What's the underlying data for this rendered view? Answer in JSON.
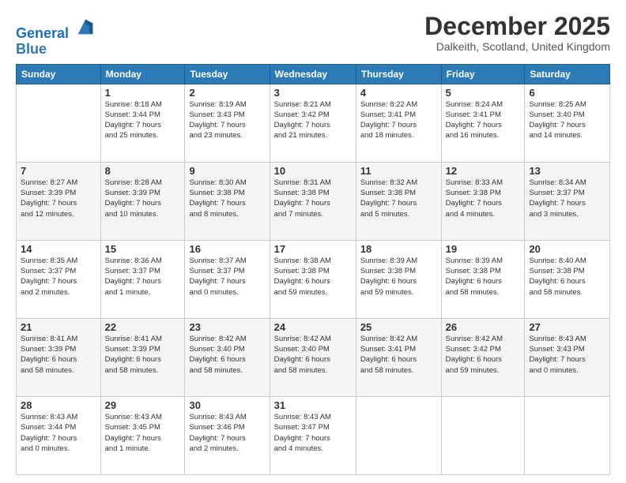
{
  "header": {
    "logo_line1": "General",
    "logo_line2": "Blue",
    "month_title": "December 2025",
    "location": "Dalkeith, Scotland, United Kingdom"
  },
  "days_of_week": [
    "Sunday",
    "Monday",
    "Tuesday",
    "Wednesday",
    "Thursday",
    "Friday",
    "Saturday"
  ],
  "weeks": [
    [
      {
        "day": "",
        "info": ""
      },
      {
        "day": "1",
        "info": "Sunrise: 8:18 AM\nSunset: 3:44 PM\nDaylight: 7 hours\nand 25 minutes."
      },
      {
        "day": "2",
        "info": "Sunrise: 8:19 AM\nSunset: 3:43 PM\nDaylight: 7 hours\nand 23 minutes."
      },
      {
        "day": "3",
        "info": "Sunrise: 8:21 AM\nSunset: 3:42 PM\nDaylight: 7 hours\nand 21 minutes."
      },
      {
        "day": "4",
        "info": "Sunrise: 8:22 AM\nSunset: 3:41 PM\nDaylight: 7 hours\nand 18 minutes."
      },
      {
        "day": "5",
        "info": "Sunrise: 8:24 AM\nSunset: 3:41 PM\nDaylight: 7 hours\nand 16 minutes."
      },
      {
        "day": "6",
        "info": "Sunrise: 8:25 AM\nSunset: 3:40 PM\nDaylight: 7 hours\nand 14 minutes."
      }
    ],
    [
      {
        "day": "7",
        "info": "Sunrise: 8:27 AM\nSunset: 3:39 PM\nDaylight: 7 hours\nand 12 minutes."
      },
      {
        "day": "8",
        "info": "Sunrise: 8:28 AM\nSunset: 3:39 PM\nDaylight: 7 hours\nand 10 minutes."
      },
      {
        "day": "9",
        "info": "Sunrise: 8:30 AM\nSunset: 3:38 PM\nDaylight: 7 hours\nand 8 minutes."
      },
      {
        "day": "10",
        "info": "Sunrise: 8:31 AM\nSunset: 3:38 PM\nDaylight: 7 hours\nand 7 minutes."
      },
      {
        "day": "11",
        "info": "Sunrise: 8:32 AM\nSunset: 3:38 PM\nDaylight: 7 hours\nand 5 minutes."
      },
      {
        "day": "12",
        "info": "Sunrise: 8:33 AM\nSunset: 3:38 PM\nDaylight: 7 hours\nand 4 minutes."
      },
      {
        "day": "13",
        "info": "Sunrise: 8:34 AM\nSunset: 3:37 PM\nDaylight: 7 hours\nand 3 minutes."
      }
    ],
    [
      {
        "day": "14",
        "info": "Sunrise: 8:35 AM\nSunset: 3:37 PM\nDaylight: 7 hours\nand 2 minutes."
      },
      {
        "day": "15",
        "info": "Sunrise: 8:36 AM\nSunset: 3:37 PM\nDaylight: 7 hours\nand 1 minute."
      },
      {
        "day": "16",
        "info": "Sunrise: 8:37 AM\nSunset: 3:37 PM\nDaylight: 7 hours\nand 0 minutes."
      },
      {
        "day": "17",
        "info": "Sunrise: 8:38 AM\nSunset: 3:38 PM\nDaylight: 6 hours\nand 59 minutes."
      },
      {
        "day": "18",
        "info": "Sunrise: 8:39 AM\nSunset: 3:38 PM\nDaylight: 6 hours\nand 59 minutes."
      },
      {
        "day": "19",
        "info": "Sunrise: 8:39 AM\nSunset: 3:38 PM\nDaylight: 6 hours\nand 58 minutes."
      },
      {
        "day": "20",
        "info": "Sunrise: 8:40 AM\nSunset: 3:38 PM\nDaylight: 6 hours\nand 58 minutes."
      }
    ],
    [
      {
        "day": "21",
        "info": "Sunrise: 8:41 AM\nSunset: 3:39 PM\nDaylight: 6 hours\nand 58 minutes."
      },
      {
        "day": "22",
        "info": "Sunrise: 8:41 AM\nSunset: 3:39 PM\nDaylight: 6 hours\nand 58 minutes."
      },
      {
        "day": "23",
        "info": "Sunrise: 8:42 AM\nSunset: 3:40 PM\nDaylight: 6 hours\nand 58 minutes."
      },
      {
        "day": "24",
        "info": "Sunrise: 8:42 AM\nSunset: 3:40 PM\nDaylight: 6 hours\nand 58 minutes."
      },
      {
        "day": "25",
        "info": "Sunrise: 8:42 AM\nSunset: 3:41 PM\nDaylight: 6 hours\nand 58 minutes."
      },
      {
        "day": "26",
        "info": "Sunrise: 8:42 AM\nSunset: 3:42 PM\nDaylight: 6 hours\nand 59 minutes."
      },
      {
        "day": "27",
        "info": "Sunrise: 8:43 AM\nSunset: 3:43 PM\nDaylight: 7 hours\nand 0 minutes."
      }
    ],
    [
      {
        "day": "28",
        "info": "Sunrise: 8:43 AM\nSunset: 3:44 PM\nDaylight: 7 hours\nand 0 minutes."
      },
      {
        "day": "29",
        "info": "Sunrise: 8:43 AM\nSunset: 3:45 PM\nDaylight: 7 hours\nand 1 minute."
      },
      {
        "day": "30",
        "info": "Sunrise: 8:43 AM\nSunset: 3:46 PM\nDaylight: 7 hours\nand 2 minutes."
      },
      {
        "day": "31",
        "info": "Sunrise: 8:43 AM\nSunset: 3:47 PM\nDaylight: 7 hours\nand 4 minutes."
      },
      {
        "day": "",
        "info": ""
      },
      {
        "day": "",
        "info": ""
      },
      {
        "day": "",
        "info": ""
      }
    ]
  ]
}
